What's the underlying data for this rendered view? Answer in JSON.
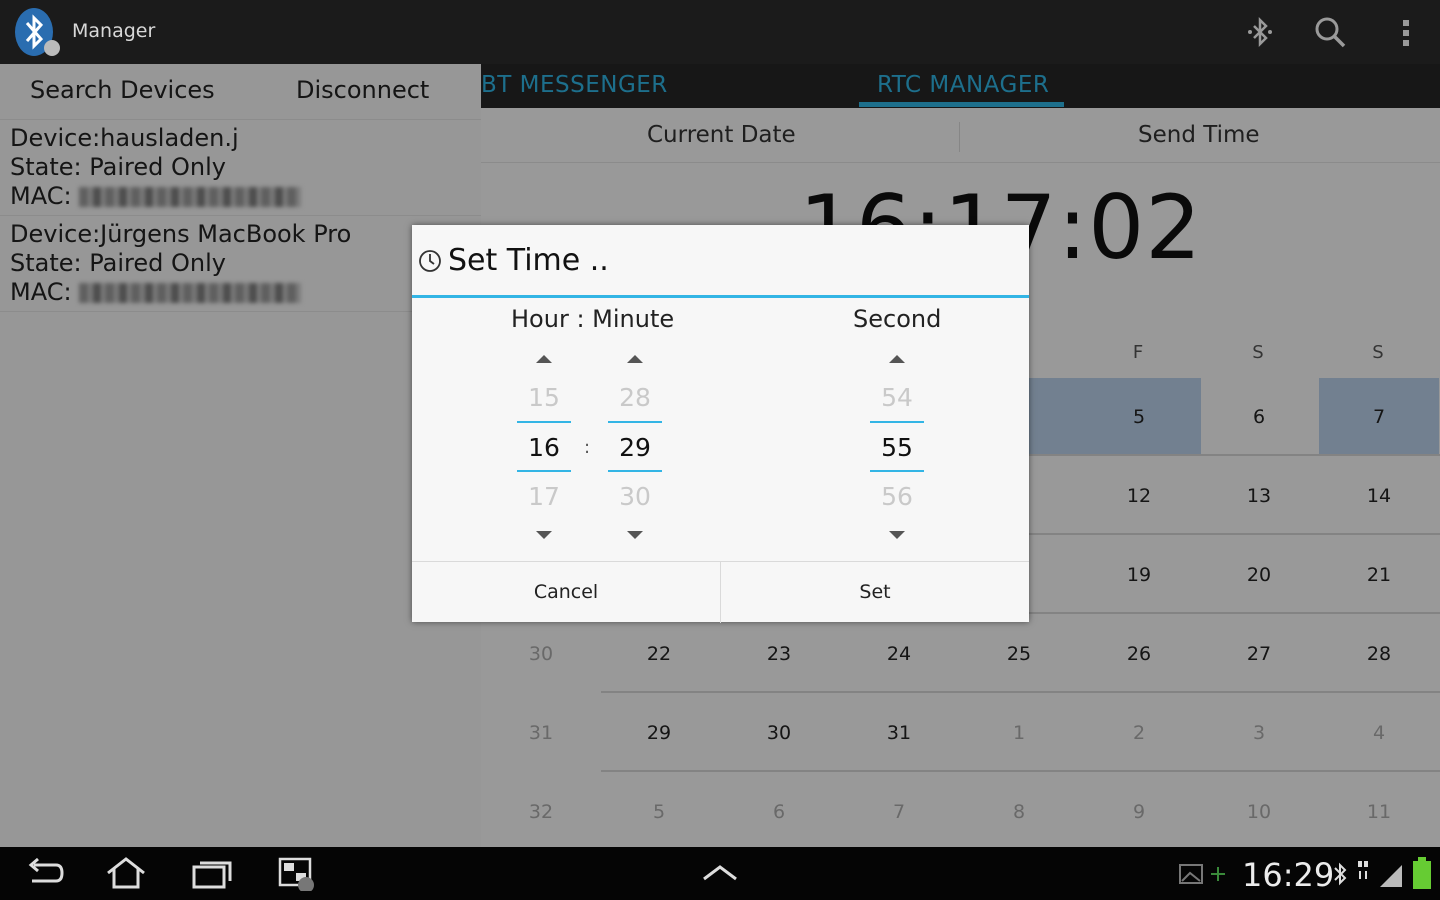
{
  "actionbar": {
    "title": "Manager",
    "icons": [
      "bluetooth-app-icon",
      "bluetooth-scan-icon",
      "search-icon",
      "overflow-menu-icon"
    ]
  },
  "left_panel": {
    "buttons": {
      "search": "Search Devices",
      "disconnect": "Disconnect"
    },
    "devices": [
      {
        "device": "Device:hausladen.j",
        "state": "State: Paired Only",
        "mac_label": "MAC:"
      },
      {
        "device": "Device:Jürgens MacBook Pro",
        "state": "State: Paired Only",
        "mac_label": "MAC:"
      }
    ]
  },
  "tabs": {
    "messenger": "BT MESSENGER",
    "rtc": "RTC MANAGER",
    "active": "RTC MANAGER"
  },
  "rtc": {
    "current_date_label": "Current Date",
    "send_time_label": "Send Time",
    "clock": "16:17:02"
  },
  "calendar": {
    "headers": [
      "F",
      "S",
      "S"
    ],
    "rows": [
      {
        "week": "",
        "days": [
          "",
          "",
          "",
          "",
          "5",
          "6",
          "7"
        ]
      },
      {
        "week": "",
        "days": [
          "",
          "",
          "",
          "",
          "12",
          "13",
          "14"
        ]
      },
      {
        "week": "",
        "days": [
          "",
          "",
          "",
          "",
          "19",
          "20",
          "21"
        ]
      },
      {
        "week": "30",
        "days": [
          "22",
          "23",
          "24",
          "25",
          "26",
          "27",
          "28"
        ]
      },
      {
        "week": "31",
        "days": [
          "29",
          "30",
          "31",
          "1",
          "2",
          "3",
          "4"
        ]
      },
      {
        "week": "32",
        "days": [
          "5",
          "6",
          "7",
          "8",
          "9",
          "10",
          "11"
        ]
      }
    ]
  },
  "dialog": {
    "title": "Set Time ..",
    "hour_minute_label": "Hour : Minute",
    "second_label": "Second",
    "hour": {
      "prev": "15",
      "value": "16",
      "next": "17"
    },
    "minute": {
      "prev": "28",
      "value": "29",
      "next": "30"
    },
    "second": {
      "prev": "54",
      "value": "55",
      "next": "56"
    },
    "separator": ":",
    "cancel": "Cancel",
    "set": "Set"
  },
  "navbar": {
    "time": "16:29",
    "icons": [
      "back-icon",
      "home-icon",
      "recent-apps-icon",
      "screenshot-icon",
      "up-chevron-icon",
      "bluetooth-status-icon",
      "signal-icon",
      "battery-icon"
    ]
  }
}
